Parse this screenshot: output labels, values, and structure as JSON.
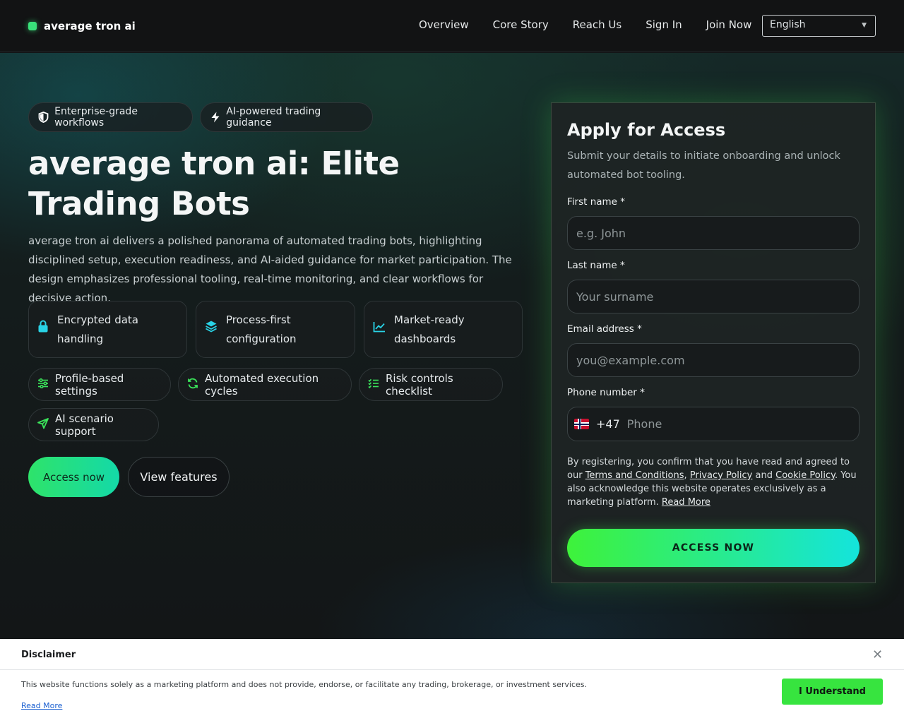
{
  "nav": {
    "brand": "average tron ai",
    "links": [
      "Overview",
      "Core Story",
      "Reach Us",
      "Sign In",
      "Join Now"
    ],
    "language": "English"
  },
  "hero": {
    "chips": [
      "Enterprise-grade workflows",
      "AI-powered trading guidance"
    ],
    "title": "average tron ai: Elite Trading Bots",
    "description": "average tron ai delivers a polished panorama of automated trading bots, highlighting disciplined setup, execution readiness, and AI-aided guidance for market participation. The design emphasizes professional tooling, real-time monitoring, and clear workflows for decisive action.",
    "features": [
      "Encrypted data handling",
      "Process-first configuration",
      "Market-ready dashboards"
    ],
    "tags": [
      "Profile-based settings",
      "Automated execution cycles",
      "Risk controls checklist",
      "AI scenario support"
    ],
    "primary_button": "Access now",
    "secondary_button": "View features"
  },
  "form": {
    "title": "Apply for Access",
    "subtitle": "Submit your details to initiate onboarding and unlock automated bot tooling.",
    "first_name_label": "First name *",
    "first_name_placeholder": "e.g. John",
    "last_name_label": "Last name *",
    "last_name_placeholder": "Your surname",
    "email_label": "Email address *",
    "email_placeholder": "you@example.com",
    "phone_label": "Phone number *",
    "phone_code": "+47",
    "phone_placeholder": "Phone",
    "legal_prefix": "By registering, you confirm that you have read and agreed to our",
    "terms": "Terms and Conditions",
    "privacy": "Privacy Policy",
    "and": "and",
    "cookie": "Cookie Policy",
    "legal_suffix": ". You also acknowledge this website operates exclusively as a marketing platform.",
    "read_more": "Read More",
    "submit": "ACCESS NOW"
  },
  "disclaimer": {
    "title": "Disclaimer",
    "close": "✕",
    "text": "This website functions solely as a marketing platform and does not provide, endorse, or facilitate any trading, brokerage, or investment services.",
    "read_more": "Read More",
    "button": "I Understand"
  },
  "colors": {
    "accent_green": "#37e43f",
    "accent_cyan": "#14e4dc",
    "icon_cyan": "#29d3e6",
    "icon_green": "#3be35a",
    "background": "#111315"
  }
}
